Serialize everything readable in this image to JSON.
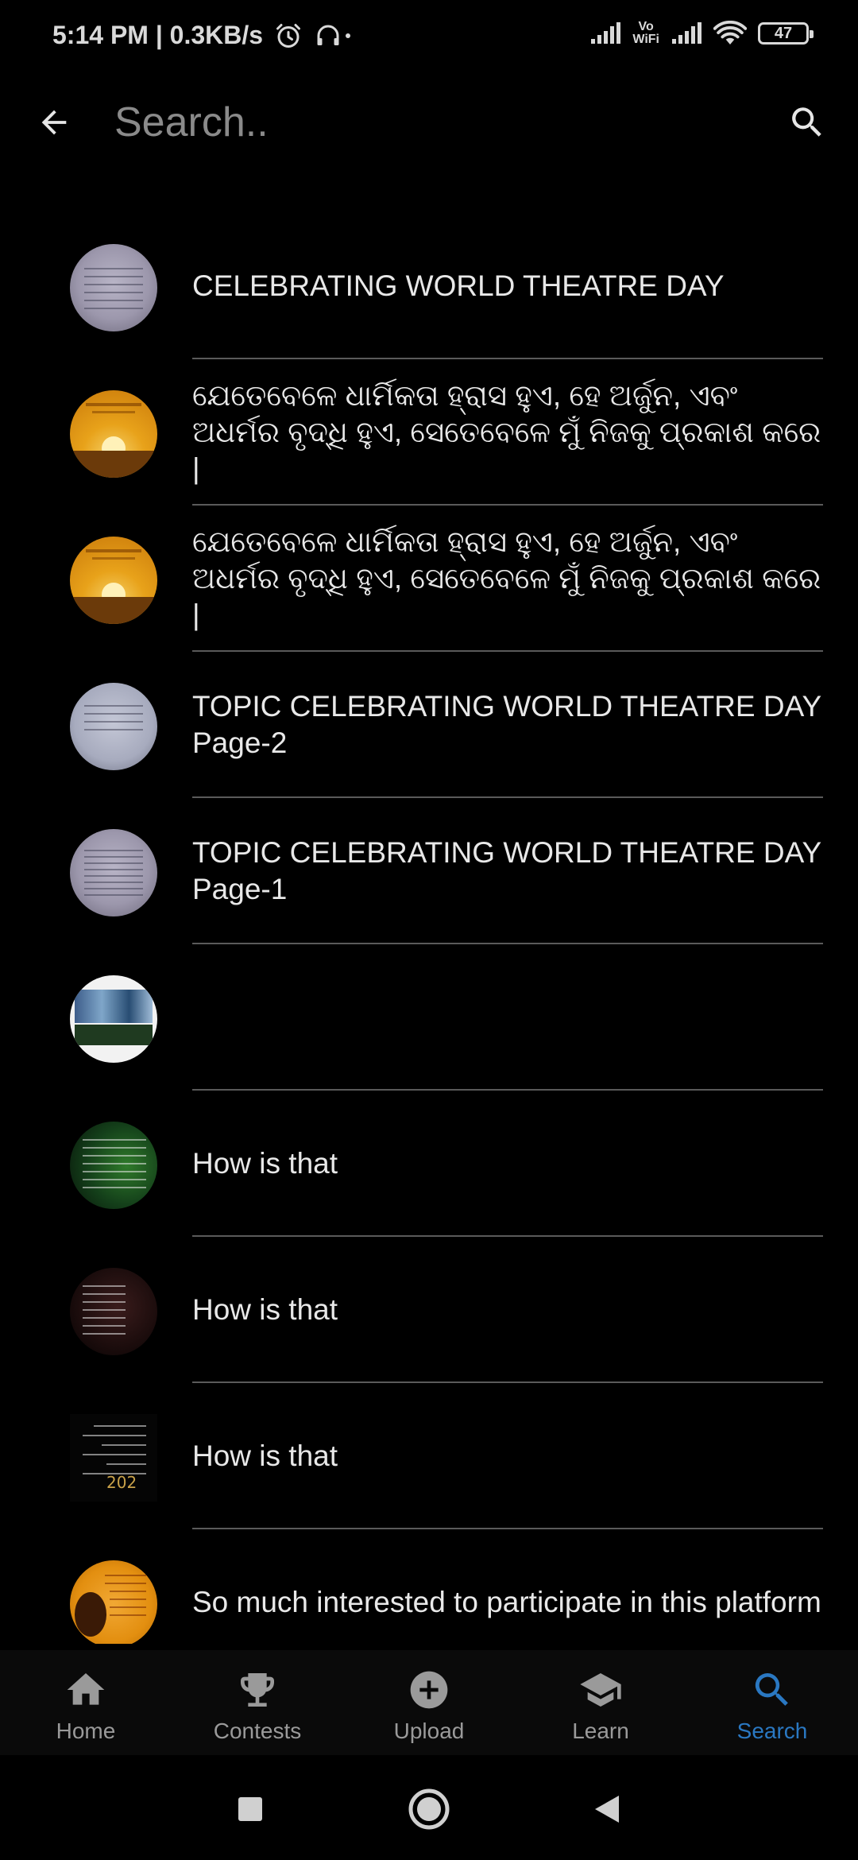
{
  "status_bar": {
    "time_speed": "5:14 PM | 0.3KB/s",
    "vowifi_top": "Vo",
    "vowifi_bottom": "WiFi",
    "battery": "47"
  },
  "toolbar": {
    "search_placeholder": "Search.."
  },
  "results": [
    {
      "title": "CELEBRATING WORLD THEATRE DAY",
      "thumbnail": "handwritten-page-thumbnail"
    },
    {
      "title": "ଯେତେବେଳେ ଧାର୍ମିକତା ହ୍ରାସ ହୁଏ, ହେ ଅର୍ଜୁନ, ଏବଂ ଅଧର୍ମର ବୃଦ୍ଧି ହୁଏ, ସେତେବେଳେ ମୁଁ ନିଜକୁ ପ୍ରକାଶ କରେ |",
      "thumbnail": "sunset-poster-thumbnail"
    },
    {
      "title": "ଯେତେବେଳେ ଧାର୍ମିକତା ହ୍ରାସ ହୁଏ, ହେ ଅର୍ଜୁନ, ଏବଂ ଅଧର୍ମର ବୃଦ୍ଧି ହୁଏ, ସେତେବେଳେ ମୁଁ ନିଜକୁ ପ୍ରକାଶ କରେ |",
      "thumbnail": "sunset-poster-thumbnail"
    },
    {
      "title": "TOPIC CELEBRATING WORLD THEATRE DAY Page-2",
      "thumbnail": "handwritten-page-thumbnail"
    },
    {
      "title": "TOPIC CELEBRATING WORLD THEATRE DAY Page-1",
      "thumbnail": "handwritten-page-thumbnail"
    },
    {
      "title": "",
      "thumbnail": "banner-thumbnail"
    },
    {
      "title": "How is that",
      "thumbnail": "green-poem-thumbnail"
    },
    {
      "title": "How is that",
      "thumbnail": "dark-poem-thumbnail"
    },
    {
      "title": "How is that",
      "thumbnail": "black-poem-thumbnail"
    },
    {
      "title": "So much interested to participate in this platform",
      "thumbnail": "orange-portrait-thumbnail"
    }
  ],
  "bottom_nav": [
    {
      "label": "Home",
      "icon": "home-icon",
      "active": false
    },
    {
      "label": "Contests",
      "icon": "trophy-icon",
      "active": false
    },
    {
      "label": "Upload",
      "icon": "plus-circle-icon",
      "active": false
    },
    {
      "label": "Learn",
      "icon": "graduation-cap-icon",
      "active": false
    },
    {
      "label": "Search",
      "icon": "search-icon",
      "active": true
    }
  ],
  "colors": {
    "background": "#000000",
    "active_tab": "#2a78c2",
    "inactive_tab": "#9a9a9a",
    "divider": "#5a5a5a"
  }
}
